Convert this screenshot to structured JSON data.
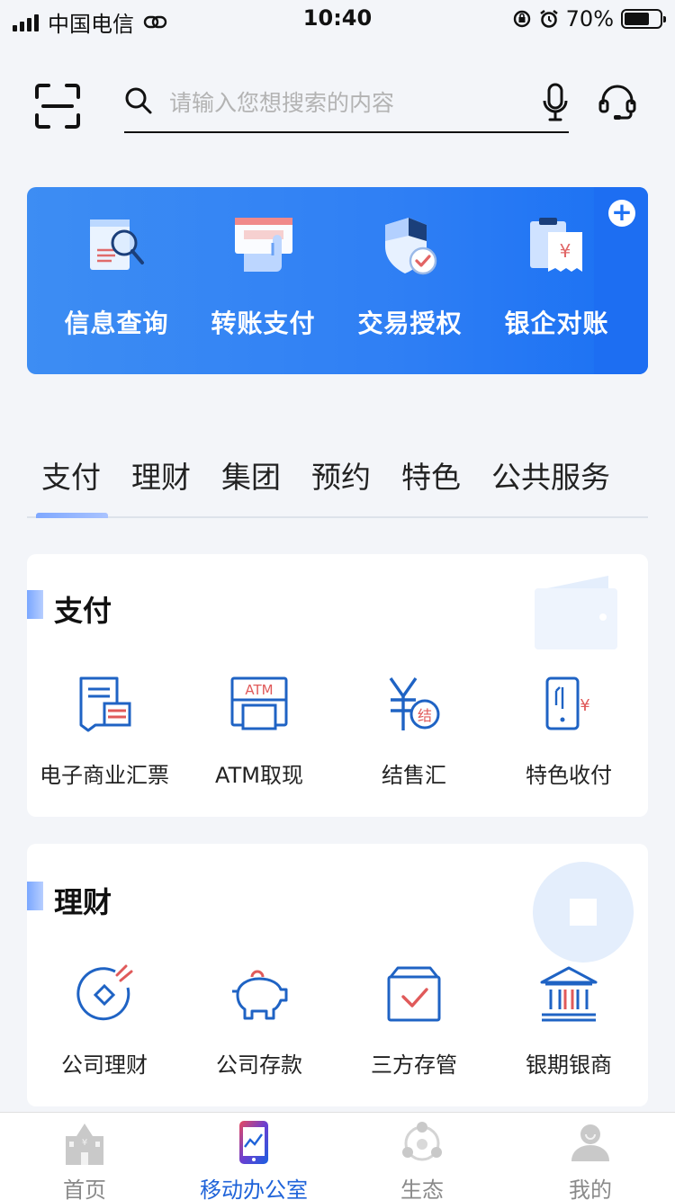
{
  "status_bar": {
    "carrier": "中国电信",
    "time": "10:40",
    "battery": "70%",
    "battery_level": 0.7
  },
  "search": {
    "placeholder": "请输入您想搜索的内容",
    "value": ""
  },
  "quick_actions": {
    "items": [
      {
        "label": "信息查询",
        "icon": "document-search-icon"
      },
      {
        "label": "转账支付",
        "icon": "card-hand-icon"
      },
      {
        "label": "交易授权",
        "icon": "shield-check-icon"
      },
      {
        "label": "银企对账",
        "icon": "bill-yuan-icon"
      }
    ],
    "add_icon": "plus-icon"
  },
  "tabs": {
    "items": [
      "支付",
      "理财",
      "集团",
      "预约",
      "特色",
      "公共服务"
    ],
    "active": "支付"
  },
  "payment_section": {
    "title": "支付",
    "items": [
      {
        "label": "电子商业汇票",
        "icon": "e-bill-icon"
      },
      {
        "label": "ATM取现",
        "icon": "atm-icon",
        "icon_text": "ATM"
      },
      {
        "label": "结售汇",
        "icon": "exchange-icon",
        "icon_text": "结"
      },
      {
        "label": "特色收付",
        "icon": "phone-yuan-icon"
      }
    ]
  },
  "finance_section": {
    "title": "理财",
    "items": [
      {
        "label": "公司理财",
        "icon": "coin-icon"
      },
      {
        "label": "公司存款",
        "icon": "piggy-bank-icon"
      },
      {
        "label": "三方存管",
        "icon": "box-check-icon"
      },
      {
        "label": "银期银商",
        "icon": "bank-building-icon"
      }
    ]
  },
  "tab_bar": {
    "items": [
      {
        "label": "首页",
        "icon": "home-building-icon"
      },
      {
        "label": "移动办公室",
        "icon": "mobile-office-icon"
      },
      {
        "label": "生态",
        "icon": "ecosystem-icon"
      },
      {
        "label": "我的",
        "icon": "user-icon"
      }
    ],
    "active": "移动办公室"
  },
  "colors": {
    "accent": "#1f63d9",
    "banner": "#2f7ff4",
    "icon_blue": "#1f63c4",
    "icon_red": "#e05a5a"
  }
}
